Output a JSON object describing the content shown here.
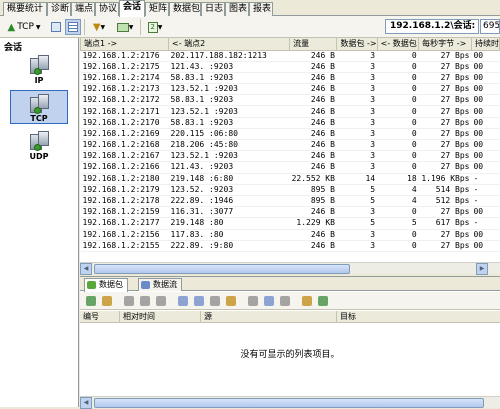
{
  "tabs": [
    "概要统计",
    "诊断",
    "端点",
    "协议",
    "会话",
    "矩阵",
    "数据包",
    "日志",
    "图表",
    "报表"
  ],
  "active_tab_index": 4,
  "toolbar": {
    "protocol_dropdown": "TCP",
    "address_label": "192.168.1.2\\会话:",
    "session_count": "695"
  },
  "left_panel": {
    "title": "会话",
    "items": [
      {
        "label": "IP",
        "icon": "server-icon"
      },
      {
        "label": "TCP",
        "icon": "server-icon",
        "selected": true
      },
      {
        "label": "UDP",
        "icon": "server-icon"
      }
    ]
  },
  "sessions_table": {
    "columns": [
      "端点1 ->",
      "<- 端点2",
      "流量",
      "数据包 ->",
      "<- 数据包",
      "每秒字节 ->",
      "持续时"
    ],
    "rows": [
      {
        "ep1": "192.168.1.2:2176",
        "ep2": "202.117.188.182:1213",
        "traffic": "246 B",
        "pkt_out": "3",
        "pkt_in": "0",
        "bps": "27 Bps",
        "dur": "00"
      },
      {
        "ep1": "192.168.1.2:2175",
        "ep2": "121.43.  :9203",
        "traffic": "246 B",
        "pkt_out": "3",
        "pkt_in": "0",
        "bps": "27 Bps",
        "dur": "00"
      },
      {
        "ep1": "192.168.1.2:2174",
        "ep2": "58.83.1  :9203",
        "traffic": "246 B",
        "pkt_out": "3",
        "pkt_in": "0",
        "bps": "27 Bps",
        "dur": "00"
      },
      {
        "ep1": "192.168.1.2:2173",
        "ep2": "123.52.1  :9203",
        "traffic": "246 B",
        "pkt_out": "3",
        "pkt_in": "0",
        "bps": "27 Bps",
        "dur": "00"
      },
      {
        "ep1": "192.168.1.2:2172",
        "ep2": "58.83.1  :9203",
        "traffic": "246 B",
        "pkt_out": "3",
        "pkt_in": "0",
        "bps": "27 Bps",
        "dur": "00"
      },
      {
        "ep1": "192.168.1.2:2171",
        "ep2": "123.52.1  :9203",
        "traffic": "246 B",
        "pkt_out": "3",
        "pkt_in": "0",
        "bps": "27 Bps",
        "dur": "00"
      },
      {
        "ep1": "192.168.1.2:2170",
        "ep2": "58.83.1  :9203",
        "traffic": "246 B",
        "pkt_out": "3",
        "pkt_in": "0",
        "bps": "27 Bps",
        "dur": "00"
      },
      {
        "ep1": "192.168.1.2:2169",
        "ep2": "220.115  :06:80",
        "traffic": "246 B",
        "pkt_out": "3",
        "pkt_in": "0",
        "bps": "27 Bps",
        "dur": "00"
      },
      {
        "ep1": "192.168.1.2:2168",
        "ep2": "218.206  :45:80",
        "traffic": "246 B",
        "pkt_out": "3",
        "pkt_in": "0",
        "bps": "27 Bps",
        "dur": "00"
      },
      {
        "ep1": "192.168.1.2:2167",
        "ep2": "123.52.1  :9203",
        "traffic": "246 B",
        "pkt_out": "3",
        "pkt_in": "0",
        "bps": "27 Bps",
        "dur": "00"
      },
      {
        "ep1": "192.168.1.2:2166",
        "ep2": "121.43.  :9203",
        "traffic": "246 B",
        "pkt_out": "3",
        "pkt_in": "0",
        "bps": "27 Bps",
        "dur": "00"
      },
      {
        "ep1": "192.168.1.2:2180",
        "ep2": "219.148  :6:80",
        "traffic": "22.552 KB",
        "pkt_out": "14",
        "pkt_in": "18",
        "bps": "1.196 KBps",
        "dur": "-"
      },
      {
        "ep1": "192.168.1.2:2179",
        "ep2": "123.52.  :9203",
        "traffic": "895 B",
        "pkt_out": "5",
        "pkt_in": "4",
        "bps": "514 Bps",
        "dur": "-"
      },
      {
        "ep1": "192.168.1.2:2178",
        "ep2": "222.89.  :1946",
        "traffic": "895 B",
        "pkt_out": "5",
        "pkt_in": "4",
        "bps": "512 Bps",
        "dur": "-"
      },
      {
        "ep1": "192.168.1.2:2159",
        "ep2": "116.31.  :3077",
        "traffic": "246 B",
        "pkt_out": "3",
        "pkt_in": "0",
        "bps": "27 Bps",
        "dur": "00"
      },
      {
        "ep1": "192.168.1.2:2177",
        "ep2": "219.148  :80",
        "traffic": "1.229 KB",
        "pkt_out": "5",
        "pkt_in": "5",
        "bps": "617 Bps",
        "dur": "-"
      },
      {
        "ep1": "192.168.1.2:2156",
        "ep2": "117.83.  :80",
        "traffic": "246 B",
        "pkt_out": "3",
        "pkt_in": "0",
        "bps": "27 Bps",
        "dur": "00"
      },
      {
        "ep1": "192.168.1.2:2155",
        "ep2": "222.89.  :9:80",
        "traffic": "246 B",
        "pkt_out": "3",
        "pkt_in": "0",
        "bps": "27 Bps",
        "dur": "00"
      }
    ]
  },
  "lower_pane": {
    "tabs": [
      "数据包",
      "数据流"
    ],
    "columns": [
      "编号",
      "相对时间",
      "源",
      "目标"
    ],
    "empty_message": "没有可显示的列表项目。"
  }
}
